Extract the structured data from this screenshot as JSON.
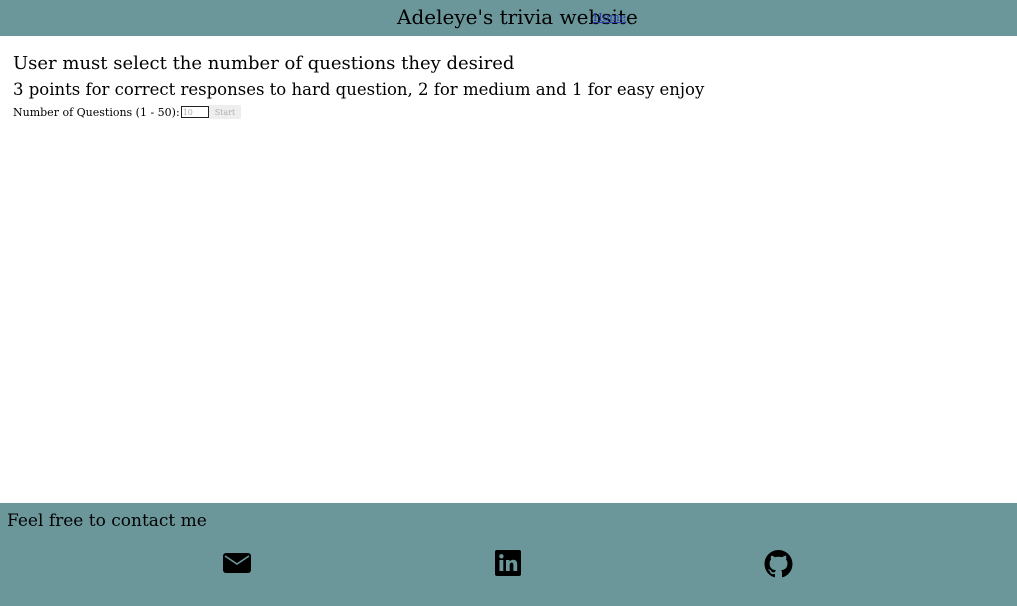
{
  "header": {
    "site_title": "Adeleye's trivia website",
    "home_link": "Home"
  },
  "main": {
    "heading": "User must select the number of questions they desired",
    "subheading": "3 points for correct responses to hard question, 2 for medium and 1 for easy enjoy",
    "quantity_label": "Number of Questions (1 - 50):",
    "quantity_placeholder": "10",
    "start_label": "Start"
  },
  "footer": {
    "title": "Feel free to contact me",
    "icons": [
      "envelope-icon",
      "linkedin-icon",
      "github-icon"
    ]
  },
  "colors": {
    "bar_background": "#6b979b",
    "link": "#2a3fb0"
  }
}
